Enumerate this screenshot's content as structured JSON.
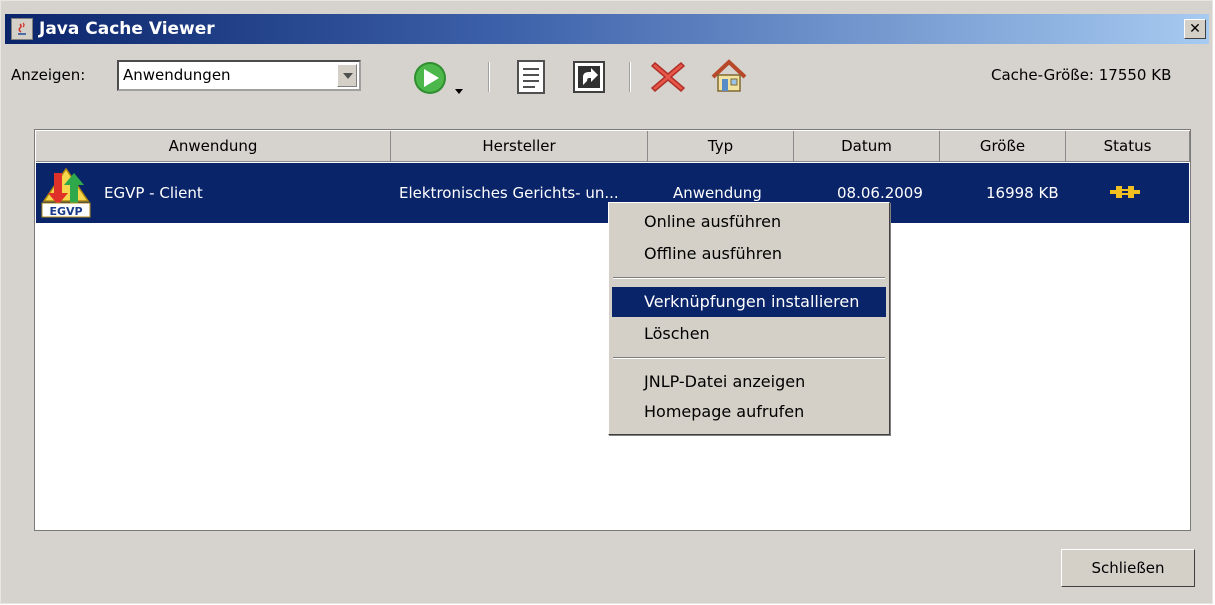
{
  "window": {
    "title": "Java Cache Viewer",
    "close_glyph": "✕",
    "title_icon": "java-icon",
    "titlebar_color": "#0a246a",
    "selection_color": "#0a246a"
  },
  "toolbar": {
    "show_label": "Anzeigen:",
    "show_value": "Anwendungen",
    "cache_size_label": "Cache-Größe: 17550 KB",
    "icons": [
      "run-icon",
      "jnlp-document-icon",
      "shortcut-icon",
      "delete-icon",
      "home-icon"
    ]
  },
  "table": {
    "headers": [
      "Anwendung",
      "Hersteller",
      "Typ",
      "Datum",
      "Größe",
      "Status"
    ],
    "rows": [
      {
        "application": "EGVP - Client",
        "vendor": "Elektronisches Gerichts- un...",
        "type": "Anwendung",
        "date": "08.06.2009",
        "size": "16998 KB",
        "status_icon": "plug-connected-icon",
        "app_icon_text": "EGVP"
      }
    ]
  },
  "context_menu": {
    "items": [
      "Online ausführen",
      "Offline ausführen",
      "Verknüpfungen installieren",
      "Löschen",
      "JNLP-Datei anzeigen",
      "Homepage aufrufen"
    ],
    "highlighted": "Verknüpfungen installieren"
  },
  "footer": {
    "close_label": "Schließen"
  }
}
